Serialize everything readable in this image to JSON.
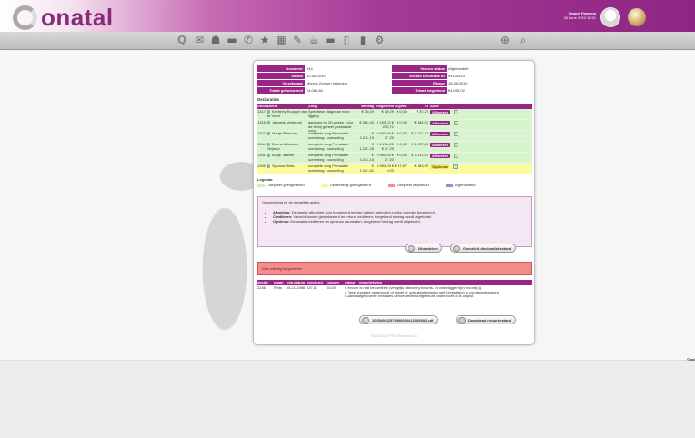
{
  "brand": {
    "logo_text": "onatal"
  },
  "user": {
    "name": "Jeanet Fassens",
    "datetime": "30 June 2010 15:51"
  },
  "toolbar": {
    "icons": [
      "search-icon",
      "mail-icon",
      "chat-icon",
      "minus-icon",
      "tools-icon",
      "star-icon",
      "calendar-icon",
      "pencil-icon",
      "coffee-icon",
      "dash-icon",
      "battery-icon",
      "bar-chart-icon",
      "settings-icon",
      "add-icon",
      "magnifier-icon"
    ]
  },
  "edge_label": "© ad",
  "summary": {
    "left": [
      {
        "label": "Dossiernr",
        "value": "144"
      },
      {
        "label": "Datum",
        "value": "12-06-2010"
      },
      {
        "label": "Verzekeraar",
        "value": "Menzis Zorg en Inkomen"
      },
      {
        "label": "Totaal gefactureerd",
        "value": "€4.088,80"
      }
    ],
    "right": [
      {
        "label": "Vecozo status",
        "value": "Afgehandeld"
      },
      {
        "label": "Vecozo Declaratie ID",
        "value": "94108243"
      },
      {
        "label": "Retour",
        "value": "18-06-2010"
      },
      {
        "label": "Totaal toegekend",
        "value": "€4.009,02"
      }
    ]
  },
  "section_title": "Declaraties",
  "table": {
    "headers": [
      "Declar.",
      "Cliënt",
      "Zorg",
      "Bedrag",
      "Toegekend",
      "Afgew.",
      "Te ontvangen",
      "Actie"
    ],
    "rows": [
      {
        "dec": "1317",
        "client": "Kimberly Rouppe van de Voort",
        "zorg": "Specifieke diagnose echo ligging",
        "bedrag": "€ 30,29",
        "toeg": "€ 30,29",
        "afg": "€ 0,00",
        "teo": "€ 30,29",
        "action": "Afboeken",
        "color": "green"
      },
      {
        "dec": "1318",
        "client": "Janneck Verbeeck",
        "zorg": "aanvang tot 20 weken, vóór de tenzij geheel postnatale zorg",
        "bedrag": "€ 384,03",
        "toeg": "€ 163,32 € 220,71",
        "afg": "€ 0,00",
        "teo": "€ 384,03",
        "action": "Afboeken",
        "color": "green"
      },
      {
        "dec": "1342",
        "client": "Marije Pillevoan",
        "zorg": "complete zorg Prenatale screening: counseling",
        "bedrag": "€ 1.011,15",
        "toeg": "€ 983,95 € 27,20",
        "afg": "€ 0,00",
        "teo": "€ 1.011,15",
        "action": "Afboeken",
        "color": "green"
      },
      {
        "dec": "1344",
        "client": "Donna Mostard - Reijman",
        "zorg": "complete zorg Prenatale screening: counseling",
        "bedrag": "€ 1.237,45",
        "toeg": "€ 1.210,25 € 27,20",
        "afg": "€ 0,00",
        "teo": "€ 1.237,45",
        "action": "Afboeken",
        "color": "green"
      },
      {
        "dec": "1351",
        "client": "Aukje Tabben",
        "zorg": "complete zorg Prenatale screening: counseling",
        "bedrag": "€ 1.011,15",
        "toeg": "€ 983,95 € 27,20",
        "afg": "€ 0,00",
        "teo": "€ 1.011,15",
        "action": "Afboeken",
        "color": "green"
      },
      {
        "dec": "1366",
        "client": "Sylvana Reits",
        "zorg": "complete zorg Prenatale screening: counseling",
        "bedrag": "€ 1.021,82",
        "toeg": "€ 983,95 € 0,00",
        "afg": "€ 37,87",
        "teo": "€ 983,95",
        "action": "Opnieuw",
        "color": "yellow"
      }
    ]
  },
  "legend": {
    "title": "Legenda",
    "items": [
      {
        "label": "Compleet goedgekeurd",
        "color": "#c9f0bb"
      },
      {
        "label": "Gedeeltelijk goedgekeurd",
        "color": "#f7f78a"
      },
      {
        "label": "Compleet afgekeurd",
        "color": "#f48c8c"
      },
      {
        "label": "Afgehandeld",
        "color": "#9090e0"
      }
    ]
  },
  "info": {
    "intro": "Omschrijving bij de mogelijke acties:",
    "items": [
      {
        "term": "Afboeken:",
        "text": "Declaratie afboeken voor toegekend bedrag (alleen gebruiken indien volledig toegekend)."
      },
      {
        "term": "Crediteren:",
        "text": "Verschil tussen gedeclareerd en retour crediteren; toegekend bedrag wordt afgeboekt."
      },
      {
        "term": "Opnieuw:",
        "text": "Declaratie crediteren en opnieuw aanmaken; toegekend bedrag wordt afgeboekt."
      }
    ]
  },
  "buttons": {
    "afhandelen": "Afhandelen",
    "overzicht": "Overzicht declaratiebestand",
    "pdf": "100000022575600000413005583.pdf",
    "download": "Download retourbestand"
  },
  "error": "Niet volledig toegewezen",
  "retour": {
    "headers": [
      "declar.",
      "naam",
      "geb.datum",
      "berekend",
      "toegew.",
      "retour",
      "omschrijving"
    ],
    "row": {
      "dec": "2246",
      "naam": "Reits",
      "geb": "05-11-1986",
      "berekend": "€37,87",
      "toegew": "€0,00",
      "notes": [
        "• Record is niet beoordeeld (vergelijk afkeuring bovens- of onderliggend(e) record(s)).",
        "• Twee prestatie onderzocht of is niet in overeenstemming met bevestiging of contractafspraken.",
        "• Aantal afgekeurde prestaties of hoeveelheid afgekeurd onderzocht of is onjuist."
      ]
    }
  },
  "footer": "KDTOLUN/PRO Revision 2.1"
}
